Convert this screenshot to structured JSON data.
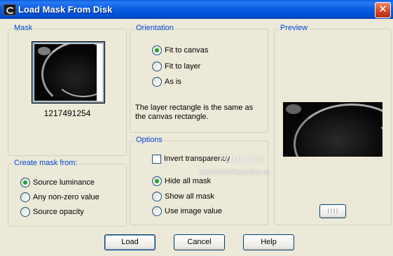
{
  "window": {
    "title": "Load Mask From Disk",
    "close_glyph": "✕"
  },
  "mask": {
    "group_label": "Mask",
    "file_name": "1217491254"
  },
  "orientation": {
    "group_label": "Orientation",
    "options": [
      {
        "label": "Fit to canvas",
        "selected": true
      },
      {
        "label": "Fit to layer",
        "selected": false
      },
      {
        "label": "As is",
        "selected": false
      }
    ],
    "description": "The layer rectangle is the same as the canvas rectangle."
  },
  "preview": {
    "group_label": "Preview"
  },
  "create_from": {
    "group_label": "Create mask from:",
    "options": [
      {
        "label": "Source luminance",
        "selected": true
      },
      {
        "label": "Any non-zero value",
        "selected": false
      },
      {
        "label": "Source opacity",
        "selected": false
      }
    ]
  },
  "options": {
    "group_label": "Options",
    "invert_label": "Invert transparency",
    "invert_checked": false,
    "radios": [
      {
        "label": "Hide all mask",
        "selected": true
      },
      {
        "label": "Show all mask",
        "selected": false
      },
      {
        "label": "Use image value",
        "selected": false
      }
    ]
  },
  "buttons": {
    "load": "Load",
    "cancel": "Cancel",
    "help": "Help"
  },
  "watermark": {
    "name": "Pinuccia",
    "site": "www.maidiregrafica.eu"
  },
  "colors": {
    "titlebar": "#0b5ee0",
    "group_label": "#0046d5",
    "face": "#ece9d8"
  }
}
